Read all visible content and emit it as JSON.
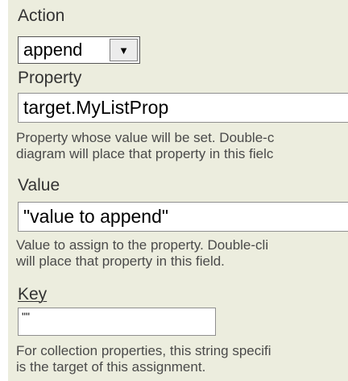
{
  "fields": {
    "action": {
      "label": "Action",
      "selected": "append"
    },
    "property": {
      "label": "Property",
      "value": "target.MyListProp",
      "help_lines": [
        "Property whose value will be set. Double-c",
        "diagram will place that property in this fielc"
      ]
    },
    "value": {
      "label": "Value",
      "value": "\"value to append\"",
      "help_lines": [
        "Value to assign to the property. Double-cli",
        "will place that property in this field."
      ]
    },
    "key": {
      "label": "Key",
      "value": "\"\"",
      "help_lines": [
        "For collection properties, this string specifi",
        "is the target of this assignment."
      ]
    }
  },
  "icons": {
    "dropdown": "triangle-down"
  },
  "colors": {
    "panel_background": "#ecedde",
    "input_background": "#ffffff",
    "input_border": "#8f8f8f"
  }
}
